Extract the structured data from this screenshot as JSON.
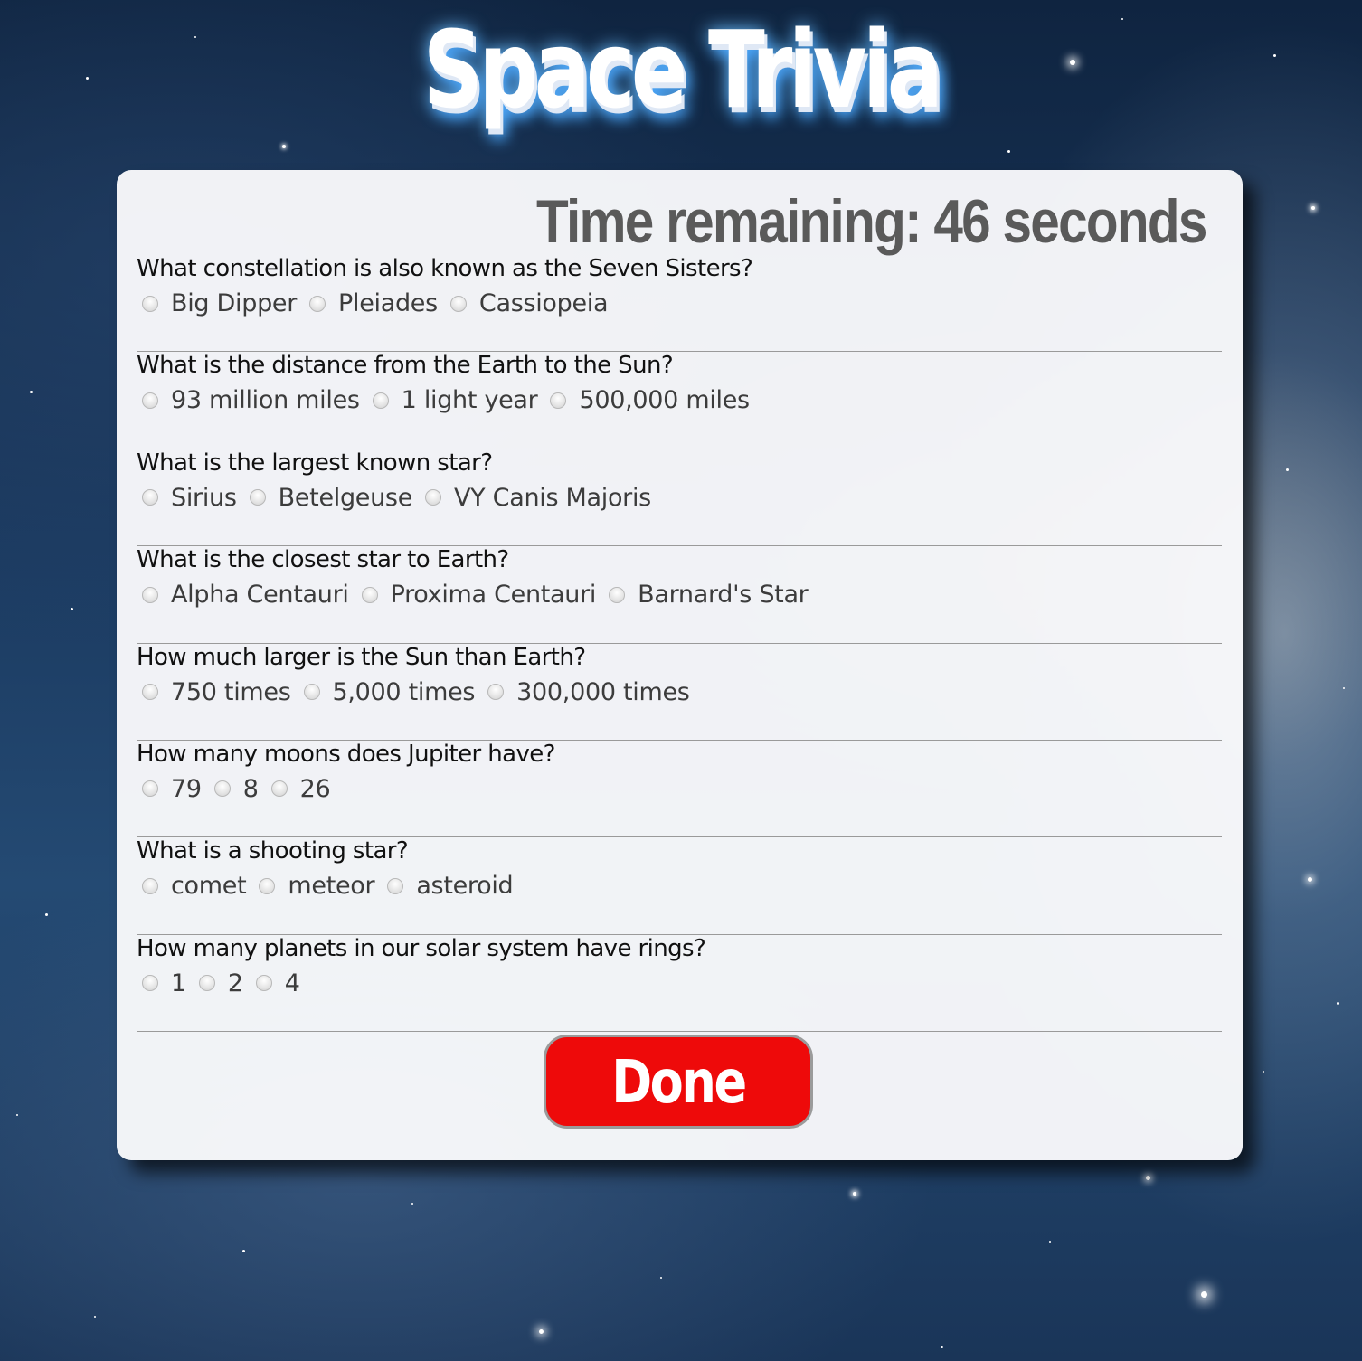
{
  "page": {
    "title": "Space Trivia"
  },
  "timer": {
    "text": "Time remaining: 46 seconds",
    "seconds_remaining": 46
  },
  "questions": [
    {
      "text": "What constellation is also known as the Seven Sisters?",
      "options": [
        "Big Dipper",
        "Pleiades",
        "Cassiopeia"
      ]
    },
    {
      "text": "What is the distance from the Earth to the Sun?",
      "options": [
        "93 million miles",
        "1 light year",
        "500,000 miles"
      ]
    },
    {
      "text": "What is the largest known star?",
      "options": [
        "Sirius",
        "Betelgeuse",
        "VY Canis Majoris"
      ]
    },
    {
      "text": "What is the closest star to Earth?",
      "options": [
        "Alpha Centauri",
        "Proxima Centauri",
        "Barnard's Star"
      ]
    },
    {
      "text": "How much larger is the Sun than Earth?",
      "options": [
        "750 times",
        "5,000 times",
        "300,000 times"
      ]
    },
    {
      "text": "How many moons does Jupiter have?",
      "options": [
        "79",
        "8",
        "26"
      ]
    },
    {
      "text": "What is a shooting star?",
      "options": [
        "comet",
        "meteor",
        "asteroid"
      ]
    },
    {
      "text": "How many planets in our solar system have rings?",
      "options": [
        "1",
        "2",
        "4"
      ]
    }
  ],
  "done_button": {
    "label": "Done"
  },
  "colors": {
    "done_button": "#ee0a0a",
    "timer_text": "#5a5a5a",
    "title_glow": "#4aa8ff",
    "panel": "#fafafc"
  }
}
